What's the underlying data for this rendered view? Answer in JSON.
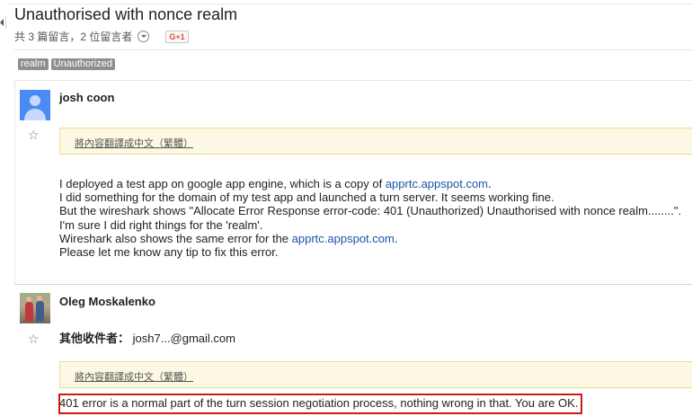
{
  "thread": {
    "title": "Unauthorised with nonce realm",
    "meta": "共 3 篇留言，2 位留言者",
    "gplus_label": "G+1",
    "tags": [
      "realm",
      "Unauthorized"
    ]
  },
  "messages": [
    {
      "author": "josh coon",
      "avatar": "default-person-icon",
      "translate_label": "將內容翻譯成中文（繁體）",
      "body": {
        "l1_a": "I deployed a test app on google app engine, which is a copy of ",
        "l1_link": "apprtc.appspot.com",
        "l1_b": ".",
        "l2": "I did something for the domain of my test app and launched a turn server. It seems working fine.",
        "l3": "But the wireshark shows \"Allocate Error Response error-code: 401 (Unauthorized) Unauthorised with nonce realm........\".",
        "l4": "I'm sure I did right things for the 'realm'.",
        "l5_a": "Wireshark also shows the same error for the ",
        "l5_link": "apprtc.appspot.com",
        "l5_b": ".",
        "l6": "Please let me know any tip to fix this error."
      }
    },
    {
      "author": "Oleg Moskalenko",
      "avatar": "user-photo",
      "recipient_label": "其他收件者：",
      "recipient_value": "josh7...@gmail.com",
      "translate_label": "將內容翻譯成中文（繁體）",
      "body": "401 error is a normal part of the turn session negotiation process, nothing wrong in that. You are OK."
    }
  ],
  "colors": {
    "link": "#1a55a8",
    "highlight_border": "#d01818",
    "translate_bg": "#fcf8e3",
    "tag_bg": "#8f8f8f"
  }
}
